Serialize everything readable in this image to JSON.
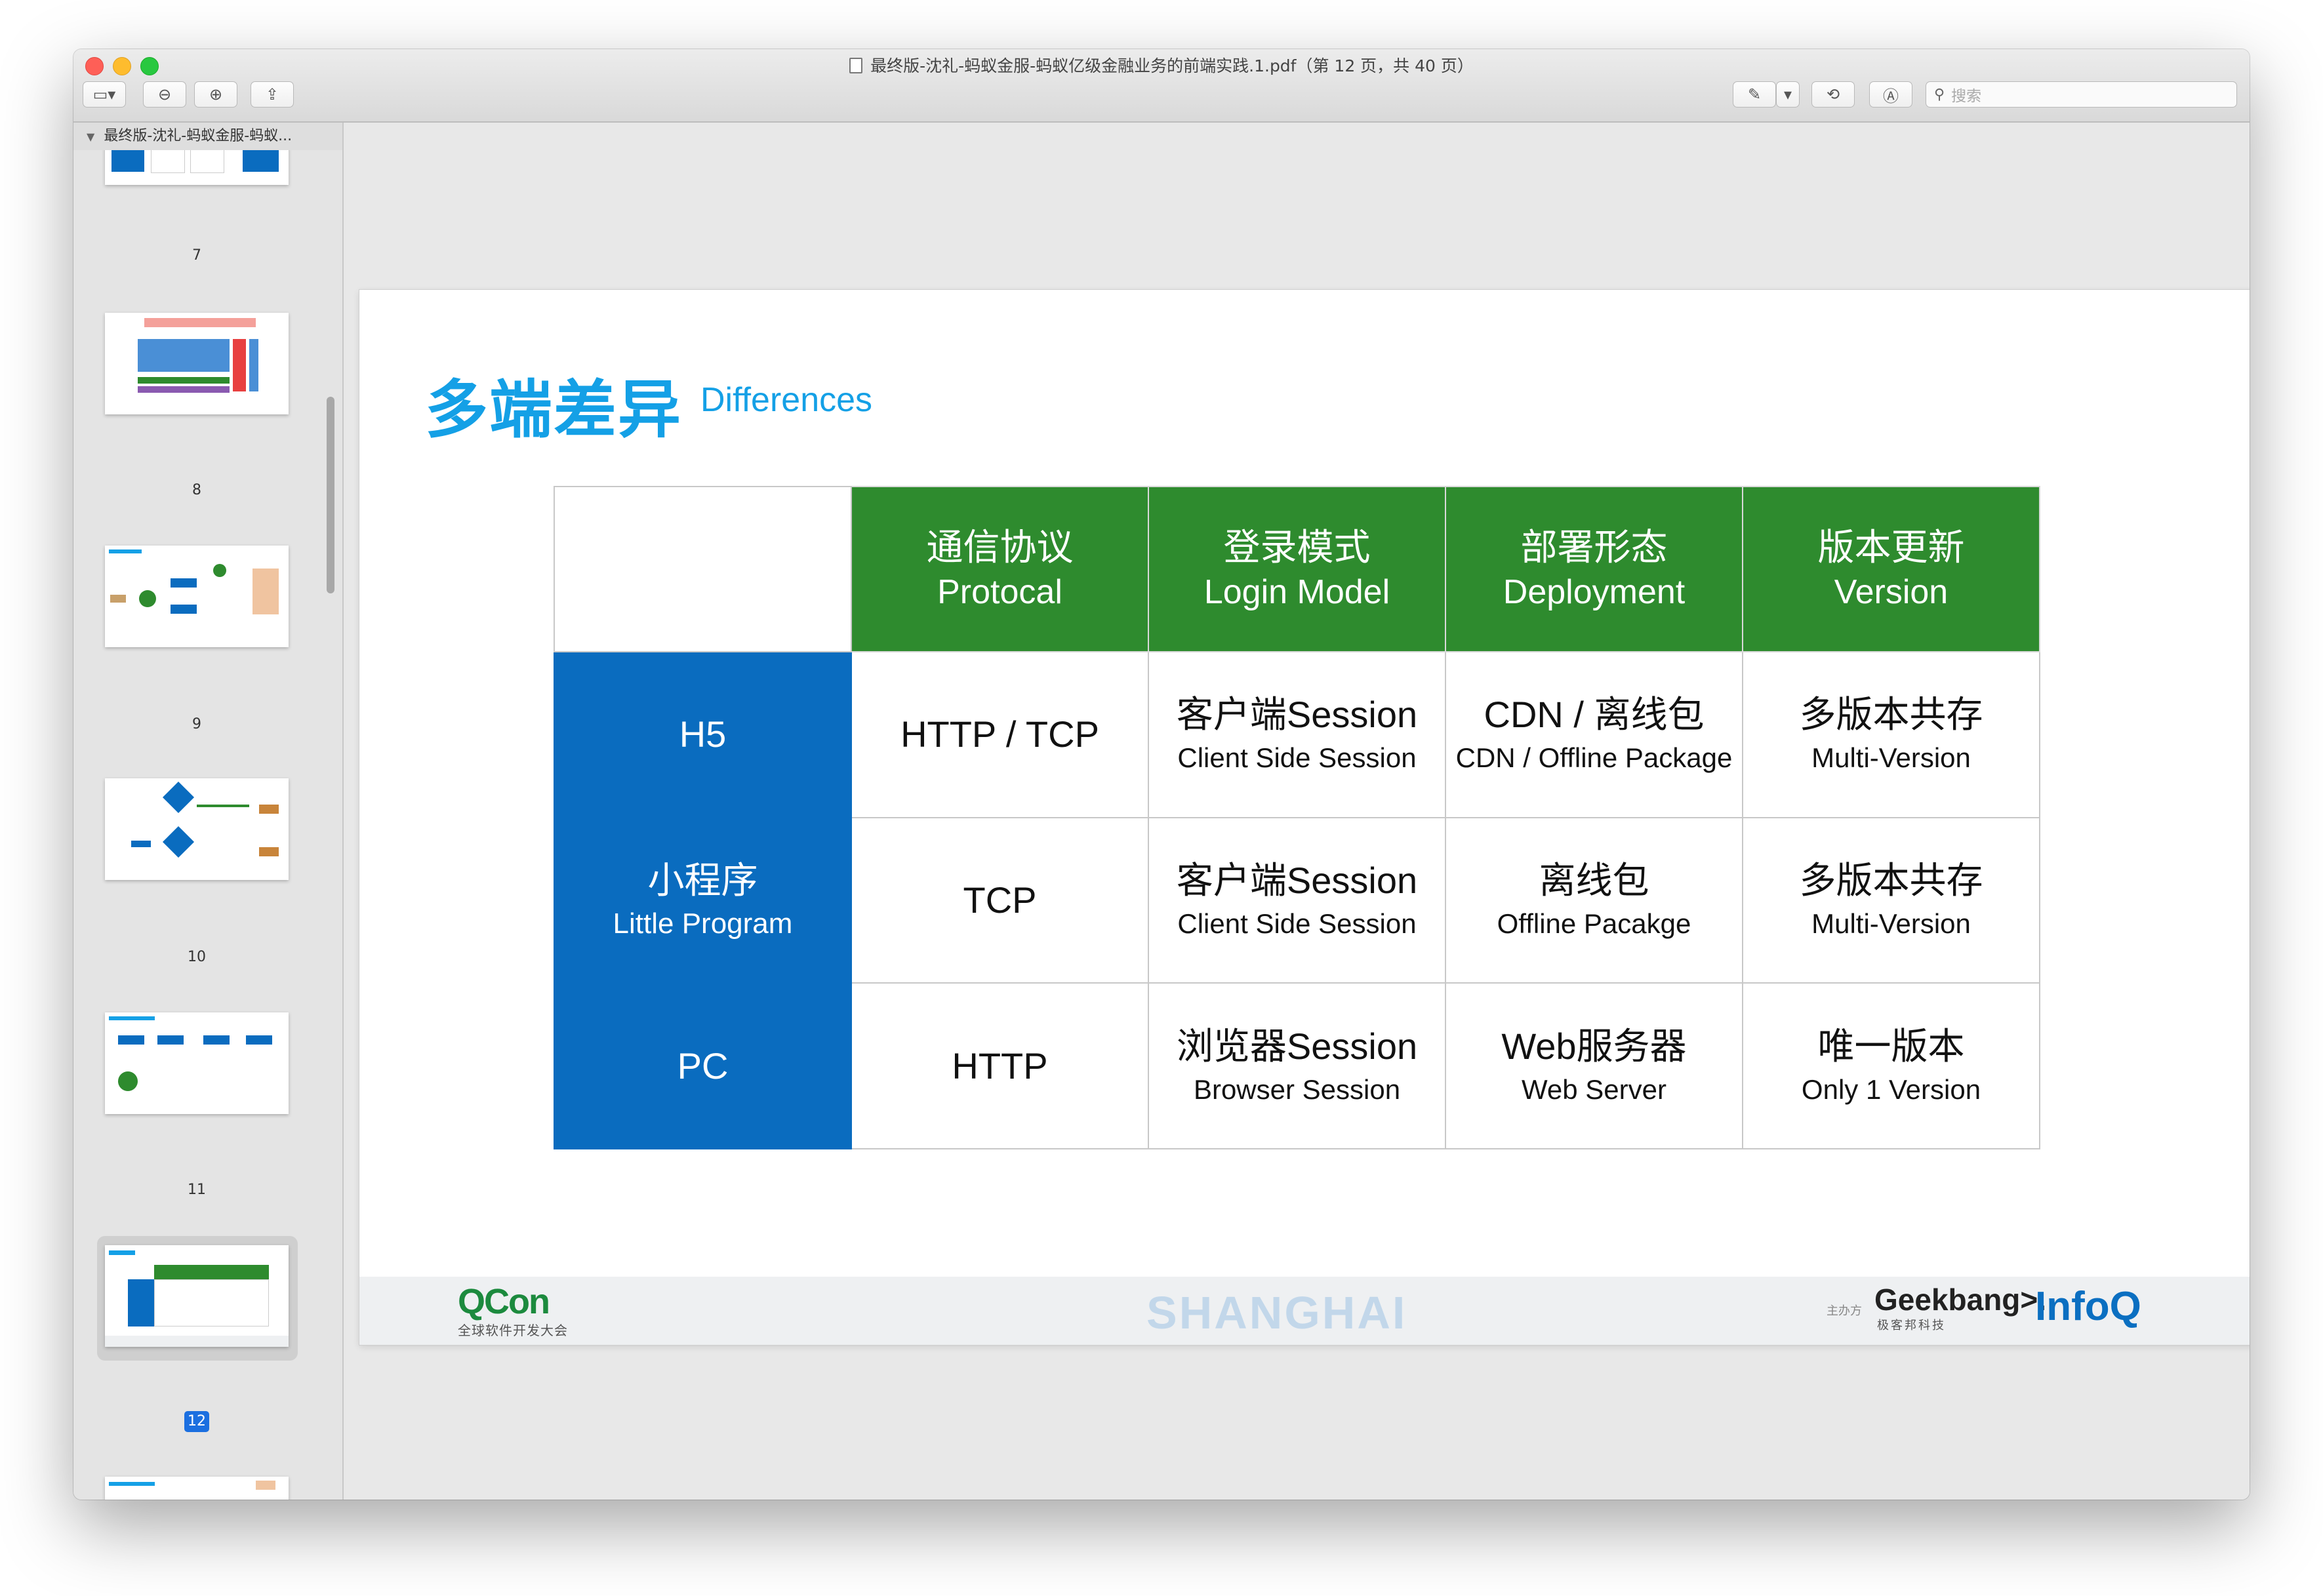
{
  "window": {
    "title": "最终版-沈礼-蚂蚁金服-蚂蚁亿级金融业务的前端实践.1.pdf（第 12 页，共 40 页）"
  },
  "toolbar": {
    "search_placeholder": "搜索"
  },
  "sidebar": {
    "doc_label": "最终版-沈礼-蚂蚁金服-蚂蚁...",
    "pages": [
      "7",
      "8",
      "9",
      "10",
      "11",
      "12"
    ],
    "selected_page": "12"
  },
  "slide": {
    "title": "多端差异",
    "subtitle": "Differences",
    "table": {
      "headers": [
        {
          "cn": "通信协议",
          "en": "Protocal"
        },
        {
          "cn": "登录模式",
          "en": "Login Model"
        },
        {
          "cn": "部署形态",
          "en": "Deployment"
        },
        {
          "cn": "版本更新",
          "en": "Version"
        }
      ],
      "rows": [
        {
          "head": {
            "main": "H5",
            "sub": ""
          },
          "cells": [
            {
              "main": "HTTP / TCP",
              "sub": ""
            },
            {
              "main": "客户端Session",
              "sub": "Client Side Session"
            },
            {
              "main": "CDN / 离线包",
              "sub": "CDN / Offline Package"
            },
            {
              "main": "多版本共存",
              "sub": "Multi-Version"
            }
          ]
        },
        {
          "head": {
            "main": "小程序",
            "sub": "Little Program"
          },
          "cells": [
            {
              "main": "TCP",
              "sub": ""
            },
            {
              "main": "客户端Session",
              "sub": "Client Side Session"
            },
            {
              "main": "离线包",
              "sub": "Offline Pacakge"
            },
            {
              "main": "多版本共存",
              "sub": "Multi-Version"
            }
          ]
        },
        {
          "head": {
            "main": "PC",
            "sub": ""
          },
          "cells": [
            {
              "main": "HTTP",
              "sub": ""
            },
            {
              "main": "浏览器Session",
              "sub": "Browser Session"
            },
            {
              "main": "Web服务器",
              "sub": "Web Server"
            },
            {
              "main": "唯一版本",
              "sub": "Only 1 Version"
            }
          ]
        }
      ]
    },
    "footer": {
      "qcon_logo": "QCon",
      "qcon_caption": "全球软件开发大会",
      "city": "SHANGHAI",
      "organizer_label": "主办方",
      "geekbang_logo": "Geekbang>.",
      "geekbang_caption": "极客邦科技",
      "infoq_logo": "InfoQ"
    }
  },
  "colors": {
    "title_blue": "#14a0e6",
    "header_green": "#2e8b2e",
    "rowhead_blue": "#0a6cbf",
    "selected_badge": "#1b6fe0"
  }
}
